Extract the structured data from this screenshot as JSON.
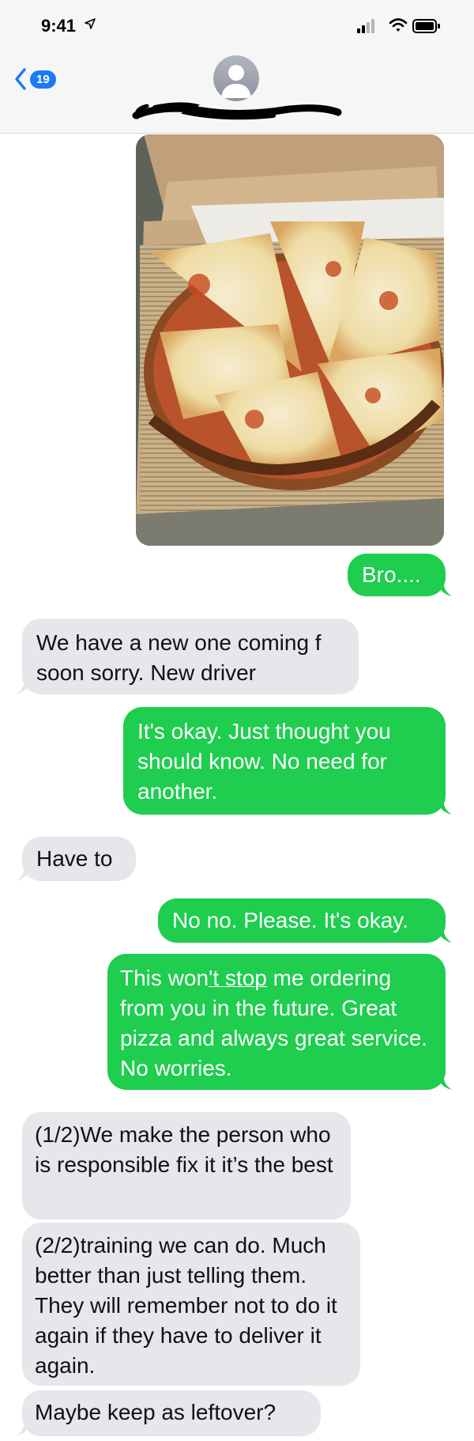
{
  "status_bar": {
    "time": "9:41",
    "icons": [
      "location-arrow-icon",
      "signal-bars-icon",
      "wifi-icon",
      "battery-icon"
    ]
  },
  "header": {
    "back_badge": "19",
    "contact_name": "",
    "avatar": "person-silhouette-icon"
  },
  "colors": {
    "sent_bubble": "#1fcd4f",
    "received_bubble": "#e6e6eb",
    "badge": "#1a7cf5"
  },
  "messages": [
    {
      "sender": "me",
      "type": "photo"
    },
    {
      "sender": "me",
      "text": "Bro...."
    },
    {
      "sender": "them",
      "text": "We have a new one coming f soon sorry. New driver"
    },
    {
      "sender": "me",
      "text": "It's okay. Just thought you should know. No need for another."
    },
    {
      "sender": "them",
      "text": "Have to"
    },
    {
      "sender": "me",
      "text": "No no. Please. It's okay."
    },
    {
      "sender": "me",
      "text_parts": [
        "This won",
        "'t stop",
        " me ordering from you in the future. Great pizza and always great service. No worries."
      ]
    },
    {
      "sender": "them",
      "text": "(1/2)We make the person who is responsible fix it it’s the best"
    },
    {
      "sender": "them",
      "text": "(2/2)training we can do. Much better than just telling them. They will remember not to do it again if they have to deliver it again."
    },
    {
      "sender": "them",
      "text": "Maybe keep as leftover?"
    }
  ]
}
